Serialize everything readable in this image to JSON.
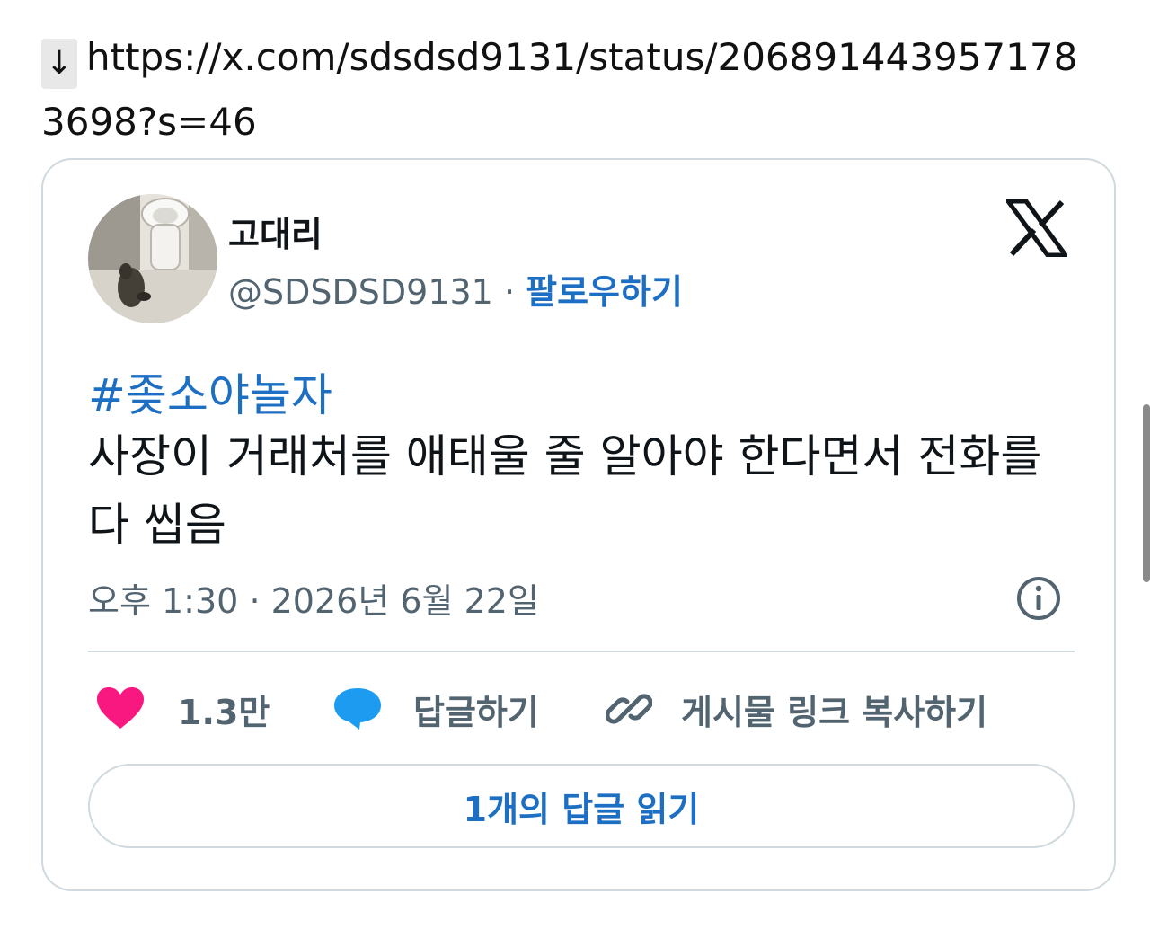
{
  "url": {
    "arrow": "↓",
    "text": "https://x.com/sdsdsd9131/status/2068914439571783698?s=46"
  },
  "tweet": {
    "display_name": "고대리",
    "handle": "@SDSDSD9131",
    "separator": "·",
    "follow_label": "팔로우하기",
    "hashtag": "#좆소야놀자",
    "text": "사장이 거래처를 애태울 줄 알아야 한다면서 전화를 다 씹음",
    "time": "오후 1:30",
    "date": "2026년 6월 22일",
    "likes": "1.3만",
    "reply_label": "답글하기",
    "copy_link_label": "게시물 링크 복사하기",
    "read_replies_label": "1개의 답글 읽기"
  },
  "icons": {
    "logo": "x-logo-icon",
    "info": "info-icon",
    "like": "heart-icon",
    "reply": "speech-bubble-icon",
    "copy": "link-icon"
  },
  "colors": {
    "link_blue": "#1d6fc4",
    "heart_pink": "#f91880",
    "reply_blue": "#1d9bf0",
    "muted_gray": "#536471",
    "border": "#cfd9de"
  }
}
